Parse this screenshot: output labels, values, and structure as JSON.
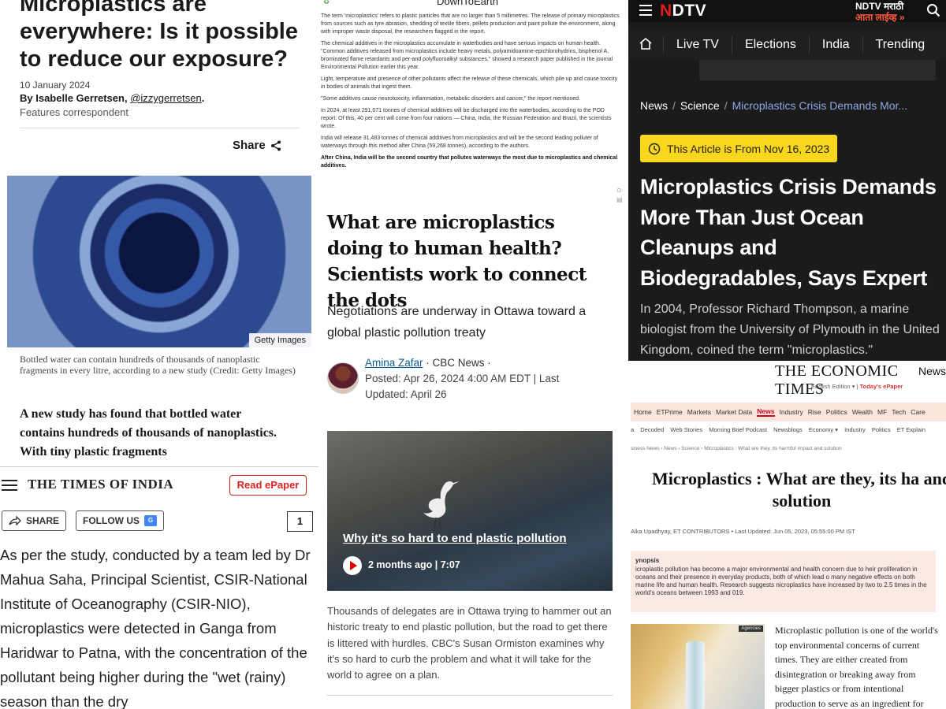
{
  "bbc": {
    "title": "Microplastics are everywhere: Is it possible to reduce our exposure?",
    "date": "10 January 2024",
    "byline_prefix": "By Isabelle Gerretsen, ",
    "byline_handle": "@izzygerretsen",
    "byline_suffix": ".",
    "role": "Features correspondent",
    "share_label": "Share",
    "image_credit": "Getty Images",
    "caption": "Bottled water can contain hundreds of thousands of nanoplastic fragments in every litre, according to a new study (Credit: Getty Images)",
    "lead": "A new study has found that bottled water contains hundreds of thousands of nanoplastics. With tiny plastic fragments"
  },
  "toi": {
    "brand": "THE TIMES OF INDIA",
    "epaper_label": "Read ePaper",
    "share_label": "SHARE",
    "follow_label": "FOLLOW US",
    "follow_badge": "G",
    "comment_count": "1",
    "body": "As per the study, conducted by a team led by Dr Mahua Saha, Principal Scientist, CSIR-National Institute of Oceanography (CSIR-NIO), microplastics were detected in Ganga from Haridwar to Patna, with the concentration of the pollutant being higher during the \"wet (rainy) season than the dry"
  },
  "dte": {
    "brand": "DownToEarth",
    "paragraphs": [
      "The term 'microplastics' refers to plastic particles that are no larger than 5 millimetres. The release of primary microplastics from sources such as tyre abrasion, shedding of textile fibres, pellets production and paint pollute the environment, along with improper waste disposal, the researchers flagged in the report.",
      "The chemical additives in the microplastics accumulate in waterbodies and have serious impacts on human health. \"Common additives released from microplastics include heavy metals, polyamidoamine-epichlorohydrins, bisphenol A, brominated flame retardants and per-and polyfluoroalkyl substances,\" showed a research paper published in the journal Environmental Pollution earlier this year.",
      "Light, temperature and presence of other pollutants affect the release of these chemicals, which pile up and cause toxicity in bodies of animals that ingest them.",
      "\"Some additives cause neurotoxicity, inflammation, metabolic disorders and cancer,\" the report mentioned.",
      "In 2024, at least 291,071 tonnes of chemical additives will be discharged into the waterbodies, according to the POD report. Of this, 40 per cent will come from four nations — China, India, the Russian Federation and Brazil, the scientists wrote.",
      "India will release 31,483 tonnes of chemical additives from microplastics and will be the second leading polluter of waterways through this method after China (59,268 tonnes), according to the authors."
    ],
    "bold_paragraph": "After China, India will be the second country that pollutes waterways the most due to microplastics and chemical additives."
  },
  "cbc": {
    "headline": "What are microplastics doing to human health? Scientists work to connect the dots",
    "subhead": "Negotiations are underway in Ottawa toward a global plastic pollution treaty",
    "author_name": "Amina Zafar",
    "author_outlet": " · CBC News ·",
    "posted": "Posted: Apr 26, 2024 4:00 AM EDT | Last Updated: April 26",
    "video_title": "Why it's so hard to end plastic pollution",
    "video_meta": "2 months ago  |  7:07",
    "video_caption": "Thousands of delegates are in Ottawa trying to hammer out an historic treaty to end plastic pollution, but the road to get there is littered with hurdles. CBC's Susan Ormiston examines why it's so hard to curb the problem and what it will take for the world to agree on a plan."
  },
  "ndtv": {
    "logo_prefix": "N",
    "logo_suffix": "DTV",
    "marathi_title": "NDTV मराठी",
    "marathi_live": "आता लाईव्ह »",
    "nav": [
      "Live TV",
      "Elections",
      "India",
      "Trending"
    ],
    "crumbs": [
      "News",
      "Science",
      "Microplastics Crisis Demands Mor..."
    ],
    "badge": "This Article is From Nov 16, 2023",
    "headline": "Microplastics Crisis Demands More Than Just Ocean Cleanups and Biodegradables, Says Expert",
    "summary": "In 2004, Professor Richard Thompson, a marine biologist from the University of Plymouth in the United Kingdom, coined the term \"microplastics.\""
  },
  "et": {
    "brand": "THE ECONOMIC TIMES",
    "brand_news": "News",
    "edition_prefix": "English Edition ▾  |  ",
    "edition_link": "Today's ePaper",
    "nav1": [
      "Home",
      "ETPrime",
      "Markets",
      "Market Data",
      "News",
      "Industry",
      "Rise",
      "Politics",
      "Wealth",
      "MF",
      "Tech",
      "Care"
    ],
    "nav2": [
      "a",
      "Decoded",
      "Web Stories",
      "Morning Brief Podcast",
      "Newsblogs",
      "Economy ▾",
      "Industry",
      "Politics",
      "ET Explain"
    ],
    "crumbs": "siness News › News › Science › Microplastics : What are they, its harmful impact and solution",
    "title": "Microplastics : What are they, its ha and solution",
    "author": "Alka Upadhyay, ET CONTRIBUTORS • Last Updated: Jun 05, 2023, 05:55:00 PM IST",
    "synopsis_label": "ynopsis",
    "synopsis": "icroplastic pollution has become a major environmental and health concern due to heir proliferation in oceans and their presence in everyday products, both of which lead o many negative effects on both marine life and human health. Research suggests nicroplastics have increased by two to 2.5 times in the world's oceans between 1993 and 019.",
    "thumb_tag": "Agencies",
    "paragraph": "Microplastic pollution is one of the world's top environmental concerns of current times. They are either created from disintegration or breaking away from bigger plastics or from intentional production to serve as an ingredient for"
  }
}
